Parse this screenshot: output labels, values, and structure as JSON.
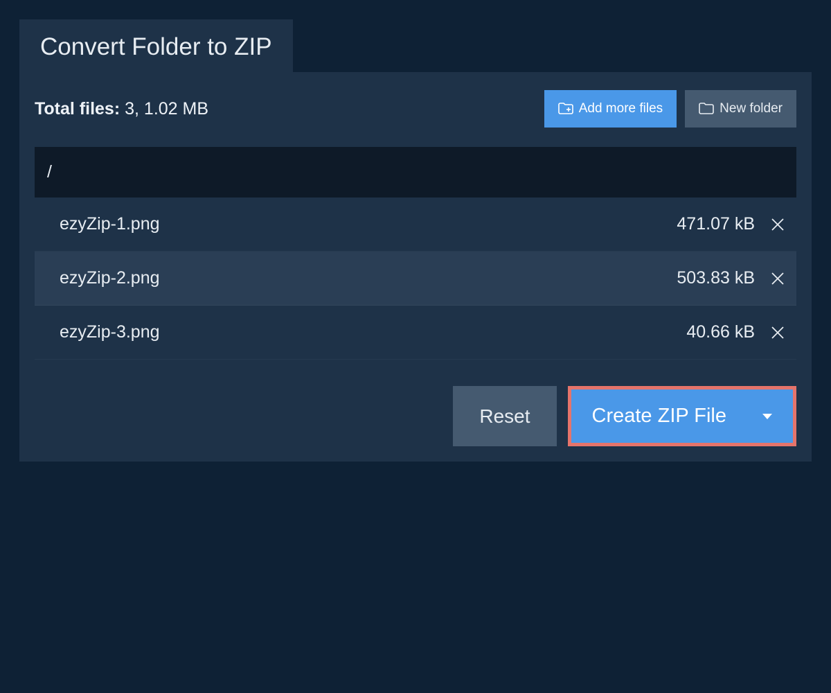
{
  "tab": {
    "title": "Convert Folder to ZIP"
  },
  "summary": {
    "label": "Total files:",
    "value": "3, 1.02 MB"
  },
  "toolbar": {
    "add_more_label": "Add more files",
    "new_folder_label": "New folder"
  },
  "breadcrumb": {
    "path": "/"
  },
  "files": [
    {
      "name": "ezyZip-1.png",
      "size": "471.07 kB"
    },
    {
      "name": "ezyZip-2.png",
      "size": "503.83 kB"
    },
    {
      "name": "ezyZip-3.png",
      "size": "40.66 kB"
    }
  ],
  "footer": {
    "reset_label": "Reset",
    "create_label": "Create ZIP File"
  },
  "colors": {
    "accent": "#4a98e8",
    "highlight_border": "#e5746b"
  }
}
